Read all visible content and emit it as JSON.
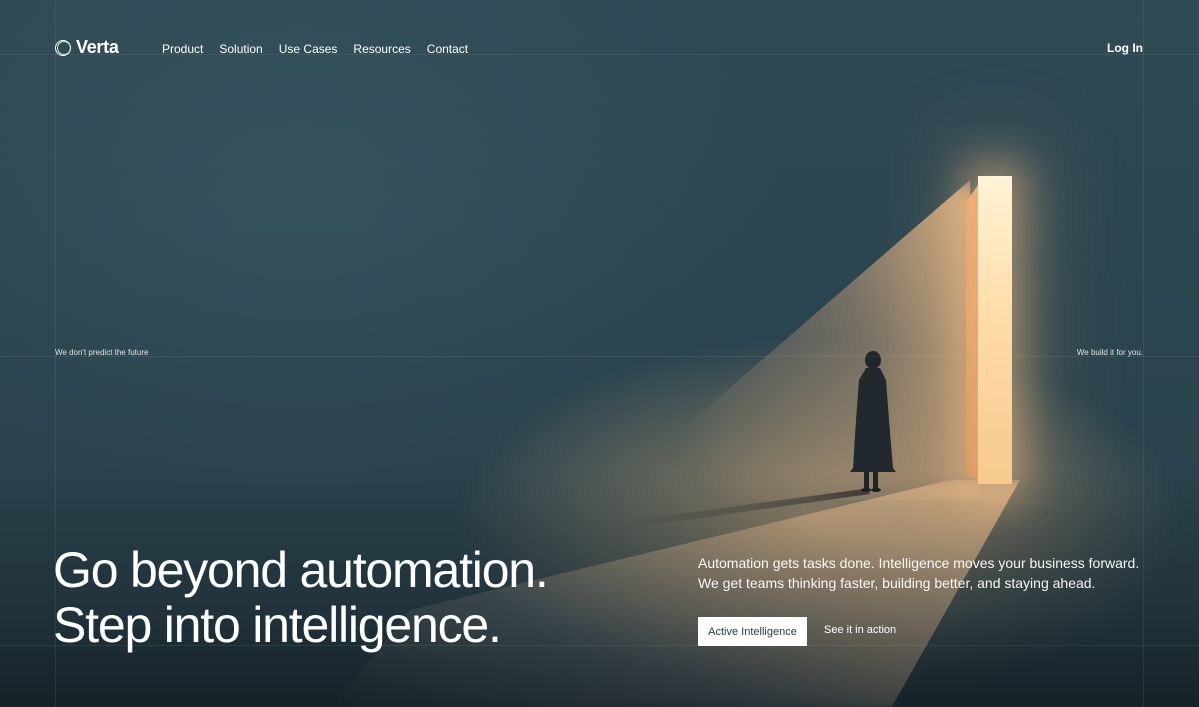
{
  "brand": {
    "name": "Verta",
    "logo_icon": "double-ring-icon"
  },
  "nav": {
    "items": [
      {
        "label": "Product"
      },
      {
        "label": "Solution"
      },
      {
        "label": "Use Cases"
      },
      {
        "label": "Resources"
      },
      {
        "label": "Contact"
      }
    ],
    "login_label": "Log In"
  },
  "side_text": {
    "left": "We don't predict the future",
    "right": "We build it for you."
  },
  "hero": {
    "headline_line1": "Go beyond automation.",
    "headline_line2": "Step into intelligence.",
    "tagline_line1": "Automation gets tasks done. Intelligence moves your business forward.",
    "tagline_line2": "We get teams thinking faster, building better, and staying ahead.",
    "primary_cta": "Active Intelligence",
    "secondary_cta": "See it in action"
  },
  "colors": {
    "background": "#2c4650",
    "door_light": "#ffdca8",
    "text": "#ffffff",
    "button_bg": "#ffffff",
    "button_text": "#2a3c44"
  }
}
